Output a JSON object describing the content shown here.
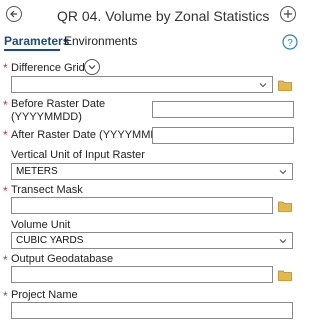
{
  "header": {
    "title": "QR 04. Volume by Zonal Statistics",
    "back_icon": "back-arrow-icon",
    "add_icon": "plus-icon"
  },
  "tabs": [
    {
      "label": "Parameters",
      "active": true
    },
    {
      "label": "Environments",
      "active": false
    }
  ],
  "help_icon": "question-mark-icon",
  "colors": {
    "accent": "#1a4c80",
    "required": "#c0392b",
    "folder": "#e6b84b",
    "help": "#2b7fd3"
  },
  "params": {
    "difference_grid": {
      "label": "Difference Grid",
      "required": true,
      "value": ""
    },
    "before_date": {
      "label_line1": "Before Raster Date",
      "label_line2": "(YYYYMMDD)",
      "required": true,
      "value": ""
    },
    "after_date": {
      "label": "After Raster Date (YYYYMMDD)",
      "required": true,
      "value": ""
    },
    "vertical_unit": {
      "label": "Vertical Unit of Input Raster",
      "required": false,
      "value": "METERS"
    },
    "transect_mask": {
      "label": "Transect Mask",
      "required": true,
      "value": ""
    },
    "volume_unit": {
      "label": "Volume Unit",
      "required": false,
      "value": "CUBIC YARDS"
    },
    "output_gdb": {
      "label": "Output Geodatabase",
      "required": true,
      "value": ""
    },
    "project_name": {
      "label": "Project Name",
      "required": true,
      "value": ""
    }
  },
  "required_marker": "*"
}
